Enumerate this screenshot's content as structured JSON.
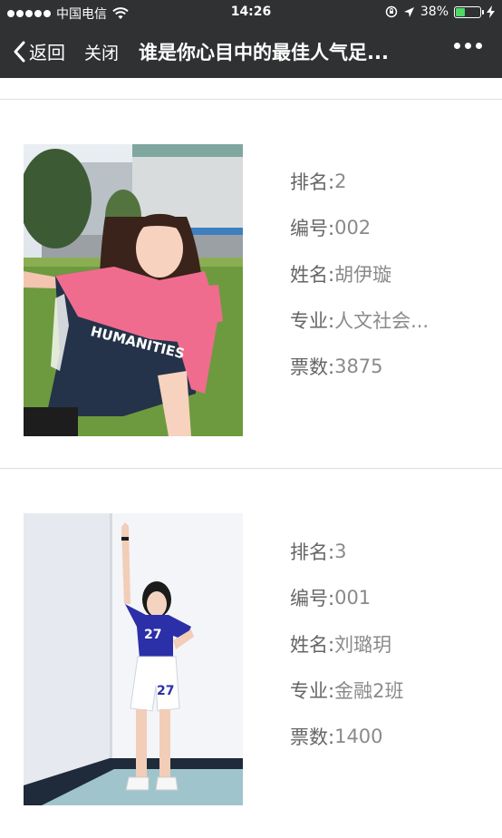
{
  "status_bar": {
    "carrier": "中国电信",
    "time": "14:26",
    "battery": "38%",
    "battery_level": 0.38,
    "battery_color": "#4cd964"
  },
  "nav": {
    "back_label": "返回",
    "close_label": "关闭",
    "title": "谁是你心目中的最佳人气足...",
    "more_icon": "more-dots-icon",
    "background": "#2f3133"
  },
  "labels": {
    "rank": "排名:",
    "number": "编号:",
    "name": "姓名:",
    "major": "专业:",
    "votes": "票数:"
  },
  "candidates": [
    {
      "rank": "2",
      "number": "002",
      "name": "胡伊璇",
      "major": "人文社会...",
      "votes": "3875",
      "jersey_text": "HUMANITIES"
    },
    {
      "rank": "3",
      "number": "001",
      "name": "刘璐玥",
      "major": "金融2班",
      "votes": "1400",
      "jersey_text": "27"
    }
  ]
}
